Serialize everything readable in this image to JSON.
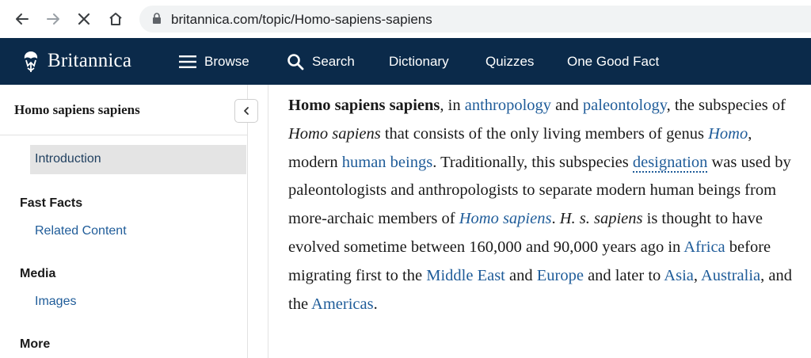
{
  "browser": {
    "url": "britannica.com/topic/Homo-sapiens-sapiens"
  },
  "header": {
    "logo_text": "Britannica",
    "nav": {
      "browse": "Browse",
      "search": "Search",
      "dictionary": "Dictionary",
      "quizzes": "Quizzes",
      "one_good_fact": "One Good Fact"
    },
    "bg_color": "#0b2a4a"
  },
  "sidebar": {
    "title": "Homo sapiens sapiens",
    "active_item": "Introduction",
    "sections": [
      {
        "heading": "Fast Facts",
        "link": "Related Content"
      },
      {
        "heading": "Media",
        "link": "Images"
      },
      {
        "heading": "More"
      }
    ]
  },
  "article": {
    "term": "Homo sapiens sapiens",
    "t1": ", in ",
    "l_anthropology": "anthropology",
    "t2": " and ",
    "l_paleontology": "paleontology",
    "t3": ", the subspecies of ",
    "i_homo_sapiens": "Homo sapiens",
    "t4": " that consists of the only living members of genus ",
    "l_homo": "Homo",
    "t5": ", modern ",
    "l_human_beings": "human beings",
    "t6": ". Traditionally, this subspecies ",
    "l_designation": "designation",
    "t7": " was used by paleontologists and anthropologists to separate modern human beings from more-archaic members of ",
    "l_homo_sapiens": "Homo sapiens",
    "t8": ". ",
    "i_hss": "H. s. sapiens",
    "t9": " is thought to have evolved sometime between 160,000 and 90,000 years ago in ",
    "l_africa": "Africa",
    "t10": " before migrating first to the ",
    "l_middle_east": "Middle East",
    "t11": " and ",
    "l_europe": "Europe",
    "t12": " and later to ",
    "l_asia": "Asia",
    "t13": ", ",
    "l_australia": "Australia",
    "t14": ", and the ",
    "l_americas": "Americas",
    "t15": "."
  },
  "icons": {
    "back": "back-arrow-icon",
    "forward": "forward-arrow-icon",
    "stop": "close-icon",
    "home": "home-icon",
    "lock": "lock-icon",
    "menu": "hamburger-menu-icon",
    "search": "search-icon",
    "collapse": "chevron-left-icon"
  },
  "colors": {
    "link": "#1f5c99",
    "active_bg": "#e4e4e4"
  }
}
